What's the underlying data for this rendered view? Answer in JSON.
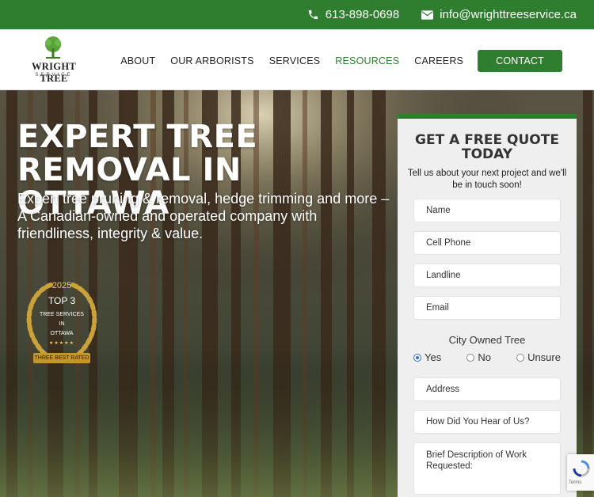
{
  "topbar": {
    "phone": "613-898-0698",
    "email": "info@wrighttreeservice.ca"
  },
  "logo": {
    "name": "WRIGHT TREE",
    "sub": "SERVICE"
  },
  "nav": {
    "items": [
      "ABOUT",
      "OUR ARBORISTS",
      "SERVICES",
      "RESOURCES",
      "CAREERS"
    ],
    "contact": "CONTACT"
  },
  "hero": {
    "headline": "EXPERT TREE REMOVAL IN OTTAWA",
    "subhead": "Expert tree pruning & removal, hedge trimming and more – A Canadian-owned and operated company with friendliness, integrity & value."
  },
  "badge": {
    "year": "2025",
    "rank": "TOP 3",
    "line1": "TREE SERVICES",
    "line2": "IN",
    "line3": "OTTAWA",
    "stars": "★★★★★",
    "ribbon": "THREE BEST RATED"
  },
  "form": {
    "title": "GET A FREE QUOTE TODAY",
    "desc": "Tell us about your next project and we'll be in touch soon!",
    "name": "Name",
    "cell": "Cell Phone",
    "landline": "Landline",
    "email": "Email",
    "city_owned_title": "City Owned Tree",
    "radio_yes": "Yes",
    "radio_no": "No",
    "radio_unsure": "Unsure",
    "address": "Address",
    "heard": "How Did You Hear of Us?",
    "description": "Brief Description of Work Requested:"
  },
  "recaptcha": {
    "terms": "Terms"
  },
  "colors": {
    "brand_green": "#2f7d2f",
    "radio_blue": "#2b6fd8"
  }
}
